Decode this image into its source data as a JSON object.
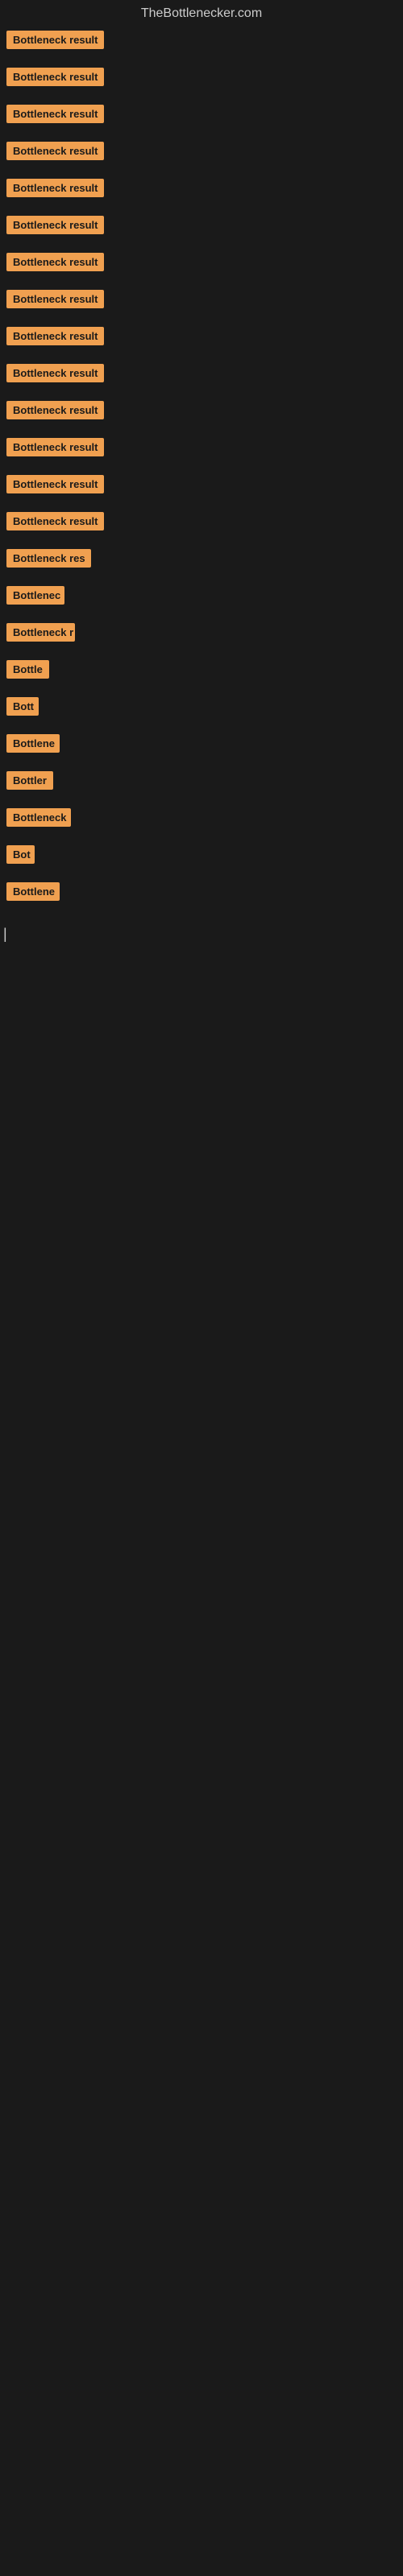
{
  "site": {
    "title": "TheBottlenecker.com"
  },
  "items": [
    {
      "id": 1,
      "label": "Bottleneck result",
      "width": 130
    },
    {
      "id": 2,
      "label": "Bottleneck result",
      "width": 130
    },
    {
      "id": 3,
      "label": "Bottleneck result",
      "width": 130
    },
    {
      "id": 4,
      "label": "Bottleneck result",
      "width": 130
    },
    {
      "id": 5,
      "label": "Bottleneck result",
      "width": 130
    },
    {
      "id": 6,
      "label": "Bottleneck result",
      "width": 130
    },
    {
      "id": 7,
      "label": "Bottleneck result",
      "width": 130
    },
    {
      "id": 8,
      "label": "Bottleneck result",
      "width": 130
    },
    {
      "id": 9,
      "label": "Bottleneck result",
      "width": 130
    },
    {
      "id": 10,
      "label": "Bottleneck result",
      "width": 130
    },
    {
      "id": 11,
      "label": "Bottleneck result",
      "width": 130
    },
    {
      "id": 12,
      "label": "Bottleneck result",
      "width": 130
    },
    {
      "id": 13,
      "label": "Bottleneck result",
      "width": 130
    },
    {
      "id": 14,
      "label": "Bottleneck result",
      "width": 130
    },
    {
      "id": 15,
      "label": "Bottleneck res",
      "width": 105
    },
    {
      "id": 16,
      "label": "Bottlenec",
      "width": 72
    },
    {
      "id": 17,
      "label": "Bottleneck r",
      "width": 85
    },
    {
      "id": 18,
      "label": "Bottle",
      "width": 58
    },
    {
      "id": 19,
      "label": "Bott",
      "width": 40
    },
    {
      "id": 20,
      "label": "Bottlene",
      "width": 66
    },
    {
      "id": 21,
      "label": "Bottler",
      "width": 58
    },
    {
      "id": 22,
      "label": "Bottleneck",
      "width": 80
    },
    {
      "id": 23,
      "label": "Bot",
      "width": 35
    },
    {
      "id": 24,
      "label": "Bottlene",
      "width": 66
    }
  ],
  "cursor": {
    "label": "|"
  },
  "colors": {
    "label_bg": "#f0a050",
    "label_text": "#1a1a1a",
    "background": "#1a1a1a",
    "site_title": "#cccccc"
  }
}
